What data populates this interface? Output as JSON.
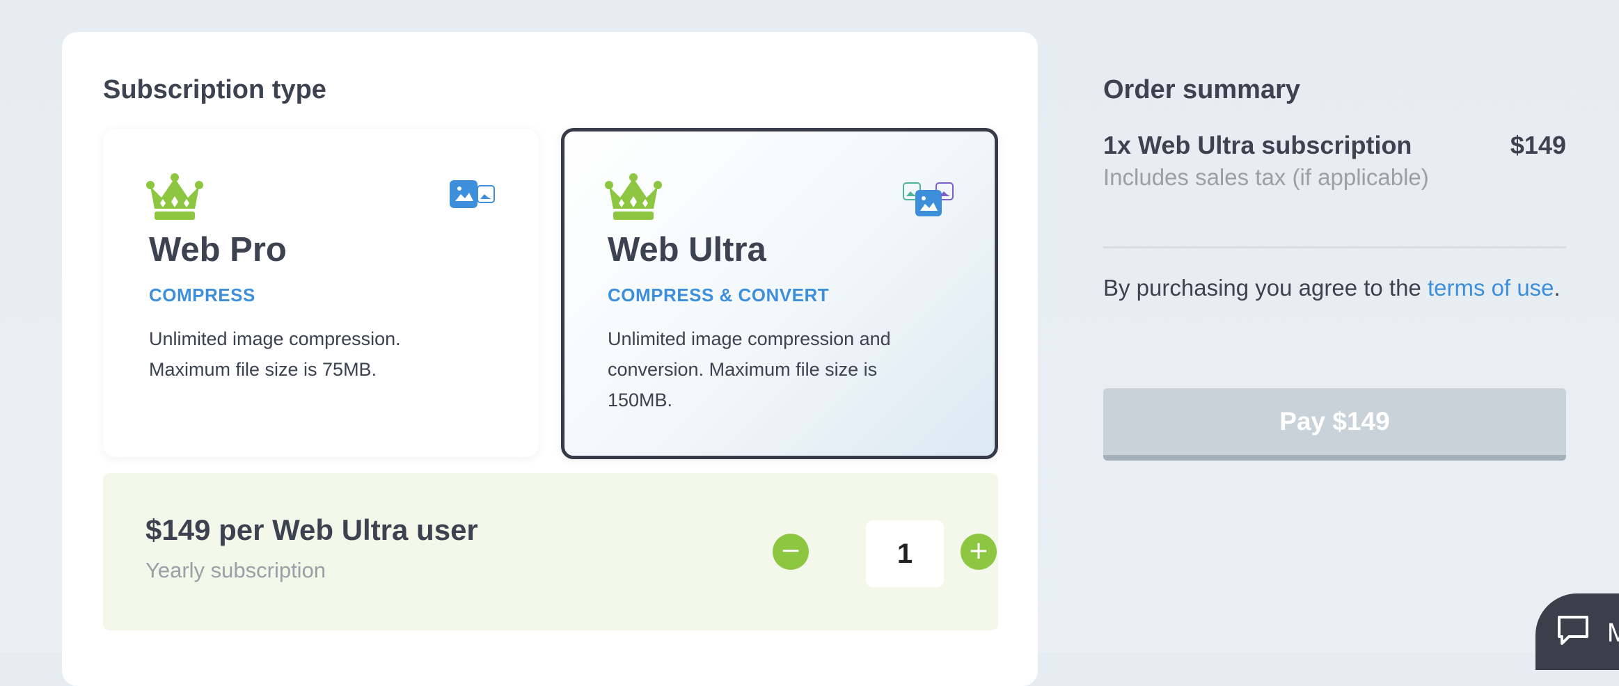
{
  "subscription": {
    "section_title": "Subscription type",
    "plans": [
      {
        "name": "Web Pro",
        "tag": "COMPRESS",
        "description": "Unlimited image compression. Maximum file size is 75MB.",
        "icons": [
          "crown-icon",
          "image-compress-icon"
        ],
        "selected": false
      },
      {
        "name": "Web Ultra",
        "tag": "COMPRESS & CONVERT",
        "description": "Unlimited image compression and conversion. Maximum file size is 150MB.",
        "icons": [
          "crown-icon",
          "image-convert-icon"
        ],
        "selected": true
      }
    ]
  },
  "pricing": {
    "title": "$149 per Web Ultra user",
    "subtitle": "Yearly subscription",
    "quantity": "1",
    "minus_label": "−",
    "plus_label": "+"
  },
  "summary": {
    "title": "Order summary",
    "line_item": "1x Web Ultra subscription",
    "line_price": "$149",
    "tax_note": "Includes sales tax (if applicable)",
    "terms_prefix": "By purchasing you agree to the ",
    "terms_link": "terms of use",
    "terms_suffix": ".",
    "pay_label": "Pay $149"
  },
  "chat": {
    "icon": "chat-icon",
    "partial_label": "M"
  },
  "colors": {
    "accent_green": "#8dc641",
    "accent_blue": "#3d8fdb",
    "dark_text": "#3d4250",
    "muted_text": "#9aa0a6",
    "selected_border": "#383c48",
    "price_box_bg": "#f3f8ea",
    "pay_button_disabled": "#c9d2d8"
  }
}
